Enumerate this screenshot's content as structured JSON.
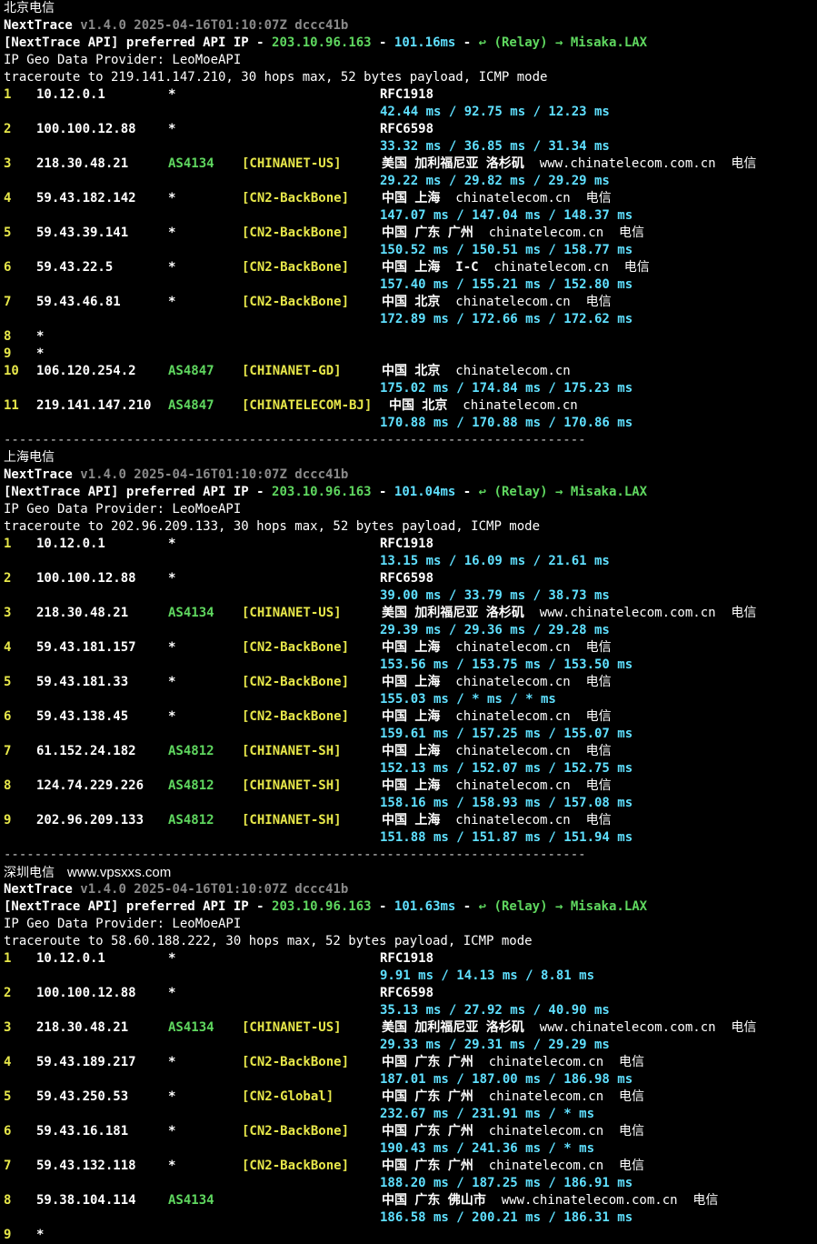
{
  "sections": [
    {
      "title": "北京电信",
      "watermark": "",
      "header": {
        "app": "NextTrace",
        "version": "v1.4.0 2025-04-16T01:10:07Z dccc41b",
        "api_label": "[NextTrace API]",
        "api_pref": "preferred API IP -",
        "api_ip": "203.10.96.163",
        "api_dash": "-",
        "api_ms": "101.16ms",
        "api_dash2": "-",
        "relay": "↩ (Relay) → Misaka.LAX",
        "geo": "IP Geo Data Provider: LeoMoeAPI",
        "traceroute": "traceroute to 219.141.147.210, 30 hops max, 52 bytes payload, ICMP mode"
      },
      "hops": [
        {
          "n": "1",
          "ip": "10.12.0.1",
          "as": "*",
          "tag": "",
          "geo": "RFC1918",
          "domain": "",
          "isp": "",
          "rtt": "42.44 ms / 92.75 ms / 12.23 ms"
        },
        {
          "n": "2",
          "ip": "100.100.12.88",
          "as": "*",
          "tag": "",
          "geo": "RFC6598",
          "domain": "",
          "isp": "",
          "rtt": "33.32 ms / 36.85 ms / 31.34 ms"
        },
        {
          "n": "3",
          "ip": "218.30.48.21",
          "as": "AS4134",
          "tag": "[CHINANET-US]",
          "geo": "美国 加利福尼亚 洛杉矶",
          "domain": "www.chinatelecom.com.cn",
          "isp": "电信",
          "rtt": "29.22 ms / 29.82 ms / 29.29 ms"
        },
        {
          "n": "4",
          "ip": "59.43.182.142",
          "as": "*",
          "tag": "[CN2-BackBone]",
          "geo": "中国 上海",
          "domain": "chinatelecom.cn",
          "isp": "电信",
          "rtt": "147.07 ms / 147.04 ms / 148.37 ms"
        },
        {
          "n": "5",
          "ip": "59.43.39.141",
          "as": "*",
          "tag": "[CN2-BackBone]",
          "geo": "中国 广东 广州",
          "domain": "chinatelecom.cn",
          "isp": "电信",
          "rtt": "150.52 ms / 150.51 ms / 158.77 ms"
        },
        {
          "n": "6",
          "ip": "59.43.22.5",
          "as": "*",
          "tag": "[CN2-BackBone]",
          "geo": "中国 上海  I-C",
          "domain": "chinatelecom.cn",
          "isp": "电信",
          "rtt": "157.40 ms / 155.21 ms / 152.80 ms"
        },
        {
          "n": "7",
          "ip": "59.43.46.81",
          "as": "*",
          "tag": "[CN2-BackBone]",
          "geo": "中国 北京",
          "domain": "chinatelecom.cn",
          "isp": "电信",
          "rtt": "172.89 ms / 172.66 ms / 172.62 ms"
        },
        {
          "n": "8",
          "ip": "*",
          "as": "",
          "tag": "",
          "geo": "",
          "domain": "",
          "isp": "",
          "rtt": ""
        },
        {
          "n": "9",
          "ip": "*",
          "as": "",
          "tag": "",
          "geo": "",
          "domain": "",
          "isp": "",
          "rtt": ""
        },
        {
          "n": "10",
          "ip": "106.120.254.2",
          "as": "AS4847",
          "tag": "[CHINANET-GD]",
          "geo": "中国 北京",
          "domain": "chinatelecom.cn",
          "isp": "",
          "rtt": "175.02 ms / 174.84 ms / 175.23 ms"
        },
        {
          "n": "11",
          "ip": "219.141.147.210",
          "as": "AS4847",
          "tag": "[CHINATELECOM-BJ]",
          "geo": "中国 北京",
          "domain": "chinatelecom.cn",
          "isp": "",
          "rtt": "170.88 ms / 170.88 ms / 170.86 ms"
        }
      ]
    },
    {
      "title": "上海电信",
      "watermark": "",
      "header": {
        "app": "NextTrace",
        "version": "v1.4.0 2025-04-16T01:10:07Z dccc41b",
        "api_label": "[NextTrace API]",
        "api_pref": "preferred API IP -",
        "api_ip": "203.10.96.163",
        "api_dash": "-",
        "api_ms": "101.04ms",
        "api_dash2": "-",
        "relay": "↩ (Relay) → Misaka.LAX",
        "geo": "IP Geo Data Provider: LeoMoeAPI",
        "traceroute": "traceroute to 202.96.209.133, 30 hops max, 52 bytes payload, ICMP mode"
      },
      "hops": [
        {
          "n": "1",
          "ip": "10.12.0.1",
          "as": "*",
          "tag": "",
          "geo": "RFC1918",
          "domain": "",
          "isp": "",
          "rtt": "13.15 ms / 16.09 ms / 21.61 ms"
        },
        {
          "n": "2",
          "ip": "100.100.12.88",
          "as": "*",
          "tag": "",
          "geo": "RFC6598",
          "domain": "",
          "isp": "",
          "rtt": "39.00 ms / 33.79 ms / 38.73 ms"
        },
        {
          "n": "3",
          "ip": "218.30.48.21",
          "as": "AS4134",
          "tag": "[CHINANET-US]",
          "geo": "美国 加利福尼亚 洛杉矶",
          "domain": "www.chinatelecom.com.cn",
          "isp": "电信",
          "rtt": "29.39 ms / 29.36 ms / 29.28 ms"
        },
        {
          "n": "4",
          "ip": "59.43.181.157",
          "as": "*",
          "tag": "[CN2-BackBone]",
          "geo": "中国 上海",
          "domain": "chinatelecom.cn",
          "isp": "电信",
          "rtt": "153.56 ms / 153.75 ms / 153.50 ms"
        },
        {
          "n": "5",
          "ip": "59.43.181.33",
          "as": "*",
          "tag": "[CN2-BackBone]",
          "geo": "中国 上海",
          "domain": "chinatelecom.cn",
          "isp": "电信",
          "rtt": "155.03 ms / * ms / * ms"
        },
        {
          "n": "6",
          "ip": "59.43.138.45",
          "as": "*",
          "tag": "[CN2-BackBone]",
          "geo": "中国 上海",
          "domain": "chinatelecom.cn",
          "isp": "电信",
          "rtt": "159.61 ms / 157.25 ms / 155.07 ms"
        },
        {
          "n": "7",
          "ip": "61.152.24.182",
          "as": "AS4812",
          "tag": "[CHINANET-SH]",
          "geo": "中国 上海",
          "domain": "chinatelecom.cn",
          "isp": "电信",
          "rtt": "152.13 ms / 152.07 ms / 152.75 ms"
        },
        {
          "n": "8",
          "ip": "124.74.229.226",
          "as": "AS4812",
          "tag": "[CHINANET-SH]",
          "geo": "中国 上海",
          "domain": "chinatelecom.cn",
          "isp": "电信",
          "rtt": "158.16 ms / 158.93 ms / 157.08 ms"
        },
        {
          "n": "9",
          "ip": "202.96.209.133",
          "as": "AS4812",
          "tag": "[CHINANET-SH]",
          "geo": "中国 上海",
          "domain": "chinatelecom.cn",
          "isp": "电信",
          "rtt": "151.88 ms / 151.87 ms / 151.94 ms"
        }
      ]
    },
    {
      "title": "深圳电信",
      "watermark": "www.vpsxxs.com",
      "header": {
        "app": "NextTrace",
        "version": "v1.4.0 2025-04-16T01:10:07Z dccc41b",
        "api_label": "[NextTrace API]",
        "api_pref": "preferred API IP -",
        "api_ip": "203.10.96.163",
        "api_dash": "-",
        "api_ms": "101.63ms",
        "api_dash2": "-",
        "relay": "↩ (Relay) → Misaka.LAX",
        "geo": "IP Geo Data Provider: LeoMoeAPI",
        "traceroute": "traceroute to 58.60.188.222, 30 hops max, 52 bytes payload, ICMP mode"
      },
      "hops": [
        {
          "n": "1",
          "ip": "10.12.0.1",
          "as": "*",
          "tag": "",
          "geo": "RFC1918",
          "domain": "",
          "isp": "",
          "rtt": "9.91 ms / 14.13 ms / 8.81 ms"
        },
        {
          "n": "2",
          "ip": "100.100.12.88",
          "as": "*",
          "tag": "",
          "geo": "RFC6598",
          "domain": "",
          "isp": "",
          "rtt": "35.13 ms / 27.92 ms / 40.90 ms"
        },
        {
          "n": "3",
          "ip": "218.30.48.21",
          "as": "AS4134",
          "tag": "[CHINANET-US]",
          "geo": "美国 加利福尼亚 洛杉矶",
          "domain": "www.chinatelecom.com.cn",
          "isp": "电信",
          "rtt": "29.33 ms / 29.31 ms / 29.29 ms"
        },
        {
          "n": "4",
          "ip": "59.43.189.217",
          "as": "*",
          "tag": "[CN2-BackBone]",
          "geo": "中国 广东 广州",
          "domain": "chinatelecom.cn",
          "isp": "电信",
          "rtt": "187.01 ms / 187.00 ms / 186.98 ms"
        },
        {
          "n": "5",
          "ip": "59.43.250.53",
          "as": "*",
          "tag": "[CN2-Global]",
          "geo": "中国 广东 广州",
          "domain": "chinatelecom.cn",
          "isp": "电信",
          "rtt": "232.67 ms / 231.91 ms / * ms"
        },
        {
          "n": "6",
          "ip": "59.43.16.181",
          "as": "*",
          "tag": "[CN2-BackBone]",
          "geo": "中国 广东 广州",
          "domain": "chinatelecom.cn",
          "isp": "电信",
          "rtt": "190.43 ms / 241.36 ms / * ms"
        },
        {
          "n": "7",
          "ip": "59.43.132.118",
          "as": "*",
          "tag": "[CN2-BackBone]",
          "geo": "中国 广东 广州",
          "domain": "chinatelecom.cn",
          "isp": "电信",
          "rtt": "188.20 ms / 187.25 ms / 186.91 ms"
        },
        {
          "n": "8",
          "ip": "59.38.104.114",
          "as": "AS4134",
          "tag": "",
          "geo": "中国 广东 佛山市",
          "domain": "www.chinatelecom.com.cn",
          "isp": "电信",
          "rtt": "186.58 ms / 200.21 ms / 186.31 ms"
        },
        {
          "n": "9",
          "ip": "*",
          "as": "",
          "tag": "",
          "geo": "",
          "domain": "",
          "isp": "",
          "rtt": ""
        }
      ]
    }
  ],
  "separator": "----------------------------------------------------------------------------"
}
